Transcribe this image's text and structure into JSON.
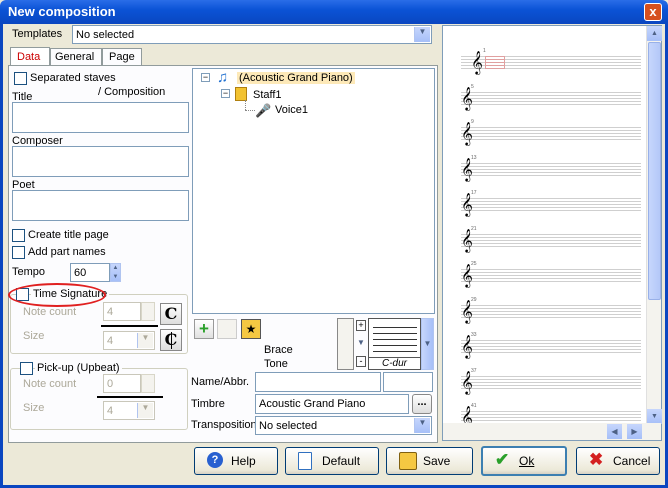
{
  "window": {
    "title": "New composition",
    "close_glyph": "x"
  },
  "templates": {
    "label": "Templates",
    "value": "No selected"
  },
  "tabs": [
    {
      "label": "Data",
      "active": true,
      "color": "#cc0000"
    },
    {
      "label": "General"
    },
    {
      "label": "Page"
    }
  ],
  "data_tab": {
    "separated_staves": "Separated staves",
    "title_label": "Title",
    "composition_label": "/ Composition",
    "composer_label": "Composer",
    "poet_label": "Poet",
    "create_title_page": "Create title page",
    "add_part_names": "Add part names",
    "tempo_label": "Tempo",
    "tempo_value": "60",
    "time_signature": "Time Signature",
    "note_count_label": "Note count",
    "note_count_value": "4",
    "size_label": "Size",
    "size_value": "4",
    "pickup_label": "Pick-up (Upbeat)",
    "pickup_note_count_label": "Note count",
    "pickup_note_count_value": "0",
    "pickup_size_label": "Size",
    "pickup_size_value": "4",
    "common_time_glyph": "C",
    "cut_time_glyph": "C"
  },
  "tree": {
    "instrument": "(Acoustic Grand Piano)",
    "staff": "Staff1",
    "voice": "Voice1",
    "expand_glyph": "−"
  },
  "staff_props": {
    "brace_label": "Brace",
    "tone_label": "Tone",
    "key_label": "C-dur",
    "plus_glyph": "+",
    "minus_glyph": "-",
    "name_label": "Name/Abbr.",
    "name_value": "",
    "abbr_value": "",
    "timbre_label": "Timbre",
    "timbre_value": "Acoustic Grand Piano",
    "timbre_browse": "...",
    "transposition_label": "Transposition",
    "transposition_value": "No selected"
  },
  "preview": {
    "measure_numbers": [
      "1",
      "5",
      "9",
      "13",
      "17",
      "21",
      "25",
      "29",
      "33",
      "37",
      "41"
    ],
    "clef_glyph": "𝄞"
  },
  "buttons": {
    "help": "Help",
    "default": "Default",
    "save": "Save",
    "ok": "Ok",
    "cancel": "Cancel"
  },
  "colors": {
    "title_bar": "#0b53d6",
    "highlight_circle": "#e02020",
    "ok_check": "#2aa02a",
    "cancel_x": "#d42020",
    "help_icon": "#2860d0"
  }
}
